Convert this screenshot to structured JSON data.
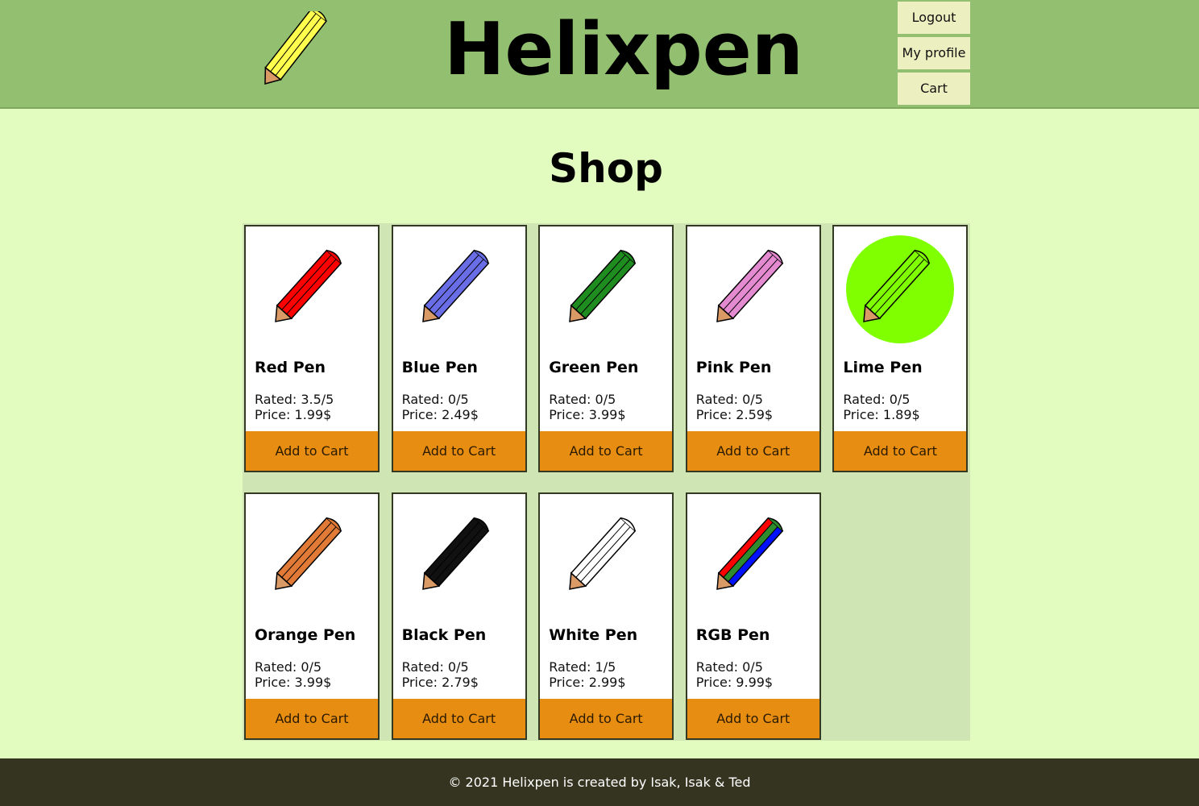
{
  "header": {
    "site_title": "Helixpen",
    "nav": [
      {
        "label": "Logout"
      },
      {
        "label": "My profile"
      },
      {
        "label": "Cart"
      }
    ]
  },
  "page_title": "Shop",
  "products": [
    {
      "name": "Red Pen",
      "rating": "Rated: 3.5/5",
      "price": "Price: 1.99$",
      "button": "Add to Cart",
      "color": "#ff0000"
    },
    {
      "name": "Blue Pen",
      "rating": "Rated: 0/5",
      "price": "Price: 2.49$",
      "button": "Add to Cart",
      "color": "#6a6ee6"
    },
    {
      "name": "Green Pen",
      "rating": "Rated: 0/5",
      "price": "Price: 3.99$",
      "button": "Add to Cart",
      "color": "#1f8c1f"
    },
    {
      "name": "Pink Pen",
      "rating": "Rated: 0/5",
      "price": "Price: 2.59$",
      "button": "Add to Cart",
      "color": "#e48ad0"
    },
    {
      "name": "Lime Pen",
      "rating": "Rated: 0/5",
      "price": "Price: 1.89$",
      "button": "Add to Cart",
      "color": "#80ff00"
    },
    {
      "name": "Orange Pen",
      "rating": "Rated: 0/5",
      "price": "Price: 3.99$",
      "button": "Add to Cart",
      "color": "#e07a36"
    },
    {
      "name": "Black Pen",
      "rating": "Rated: 0/5",
      "price": "Price: 2.79$",
      "button": "Add to Cart",
      "color": "#111111"
    },
    {
      "name": "White Pen",
      "rating": "Rated: 1/5",
      "price": "Price: 2.99$",
      "button": "Add to Cart",
      "color": "#ffffff"
    },
    {
      "name": "RGB Pen",
      "rating": "Rated: 0/5",
      "price": "Price: 9.99$",
      "button": "Add to Cart",
      "color": "rgb"
    }
  ],
  "footer": {
    "text": "© 2021 Helixpen is created by Isak, Isak & Ted"
  },
  "colors": {
    "header_bg": "#93bf70",
    "page_bg": "#e2fcc0",
    "grid_bg": "#cfe5b3",
    "button_bg": "#e78d11",
    "footer_bg": "#343421",
    "nav_button_bg": "#ecf0c0",
    "logo_pencil": "#ffff4d",
    "pencil_tip": "#d99a66"
  }
}
